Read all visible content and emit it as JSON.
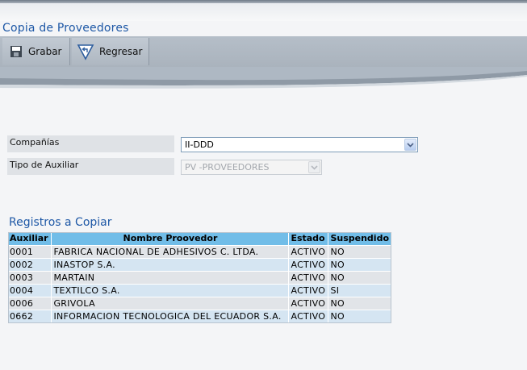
{
  "header": {
    "title": "Copia de Proveedores"
  },
  "toolbar": {
    "save_label": "Grabar",
    "back_label": "Regresar"
  },
  "form": {
    "company_label": "Compañías",
    "company_value": "II-DDD",
    "aux_type_label": "Tipo de Auxiliar",
    "aux_type_value": "PV -PROVEEDORES"
  },
  "records": {
    "title": "Registros a Copiar",
    "columns": [
      "Auxiliar",
      "Nombre Proovedor",
      "Estado",
      "Suspendido"
    ],
    "rows": [
      [
        "0001",
        "FABRICA NACIONAL DE ADHESIVOS C. LTDA.",
        "ACTIVO",
        "NO"
      ],
      [
        "0002",
        "INASTOP S.A.",
        "ACTIVO",
        "NO"
      ],
      [
        "0003",
        "MARTAIN",
        "ACTIVO",
        "NO"
      ],
      [
        "0004",
        "TEXTILCO S.A.",
        "ACTIVO",
        "SI"
      ],
      [
        "0006",
        "GRIVOLA",
        "ACTIVO",
        "NO"
      ],
      [
        "0662",
        "INFORMACION TECNOLOGICA DEL ECUADOR S.A.",
        "ACTIVO",
        "NO"
      ]
    ]
  }
}
